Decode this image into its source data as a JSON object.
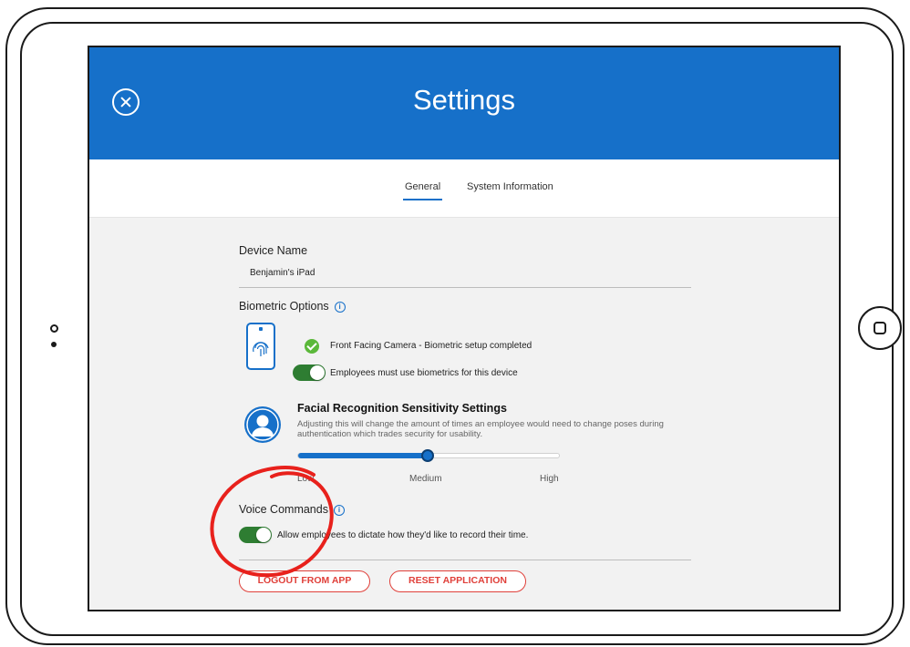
{
  "header": {
    "title": "Settings"
  },
  "tabs": [
    {
      "label": "General",
      "active": true
    },
    {
      "label": "System Information",
      "active": false
    }
  ],
  "device": {
    "label": "Device Name",
    "value": "Benjamin's iPad"
  },
  "biometric": {
    "label": "Biometric Options",
    "status_text": "Front Facing Camera - Biometric setup completed",
    "toggle_label": "Employees must use biometrics for this device",
    "toggle_on": true
  },
  "facial": {
    "title": "Facial Recognition Sensitivity Settings",
    "description": "Adjusting this will change the amount of times an employee would need to change poses during authentication which trades security for usability.",
    "slider": {
      "labels": [
        "Low",
        "Medium",
        "High"
      ],
      "selected": "Medium",
      "level_fraction": 0.5
    }
  },
  "voice": {
    "label": "Voice Commands",
    "toggle_label": "Allow employees to dictate how they'd like to record their time.",
    "toggle_on": true
  },
  "buttons": {
    "logout": "LOGOUT FROM APP",
    "reset": "RESET APPLICATION"
  },
  "colors": {
    "header_blue": "#1670c9",
    "toggle_green": "#2e7d32",
    "check_green": "#5bb83a",
    "button_red": "#e0403a",
    "annotation_red": "#e8211c"
  },
  "icons": {
    "close": "close-circle-icon",
    "info": "info-icon",
    "phone_fingerprint": "phone-fingerprint-icon",
    "check": "check-circle-icon",
    "person": "person-avatar-icon",
    "home": "home-button-icon"
  }
}
